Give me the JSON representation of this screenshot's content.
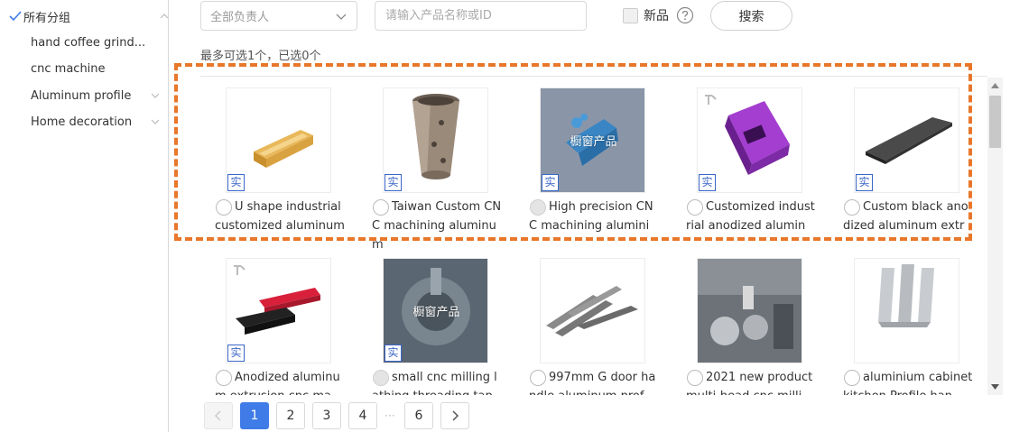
{
  "sidebar": {
    "root": {
      "label": "所有分组"
    },
    "items": [
      {
        "label": "hand coffee grind..."
      },
      {
        "label": "cnc machine"
      },
      {
        "label": "Aluminum profile"
      },
      {
        "label": "Home decoration"
      }
    ]
  },
  "toolbar": {
    "owner_select": {
      "value": "全部负责人"
    },
    "search": {
      "placeholder": "请输入产品名称或ID",
      "value": ""
    },
    "new_label": "新品",
    "search_button": "搜索"
  },
  "selection_info": "最多可选1个，已选0个",
  "products": [
    {
      "name": "U shape industrial customized aluminum",
      "badge": "实",
      "window_label": "",
      "disabled": false
    },
    {
      "name": "Taiwan Custom CNC machining aluminum",
      "badge": "实",
      "window_label": "",
      "disabled": false
    },
    {
      "name": "High precision CNC machining alumini",
      "badge": "实",
      "window_label": "橱窗产品",
      "disabled": true
    },
    {
      "name": "Customized industrial anodized alumin",
      "badge": "实",
      "window_label": "",
      "disabled": false
    },
    {
      "name": "Custom black anodized aluminum extr",
      "badge": "实",
      "window_label": "",
      "disabled": false
    },
    {
      "name": "Anodized aluminum extrusion cnc ma",
      "badge": "实",
      "window_label": "",
      "disabled": false
    },
    {
      "name": "small cnc milling lathing threading tap",
      "badge": "实",
      "window_label": "橱窗产品",
      "disabled": true
    },
    {
      "name": "997mm G door handle aluminum prof",
      "badge": "",
      "window_label": "",
      "disabled": false
    },
    {
      "name": "2021 new product multi-head cnc milli",
      "badge": "",
      "window_label": "",
      "disabled": false
    },
    {
      "name": "aluminium cabinet kitchen Profile han",
      "badge": "",
      "window_label": "",
      "disabled": false
    }
  ],
  "pagination": {
    "pages": [
      "1",
      "2",
      "3",
      "4",
      "6"
    ],
    "ellipsis": "···",
    "current": "1"
  },
  "colors": {
    "accent": "#3f7ce8",
    "annotation": "#e8772a",
    "badge": "#3a66c8"
  }
}
